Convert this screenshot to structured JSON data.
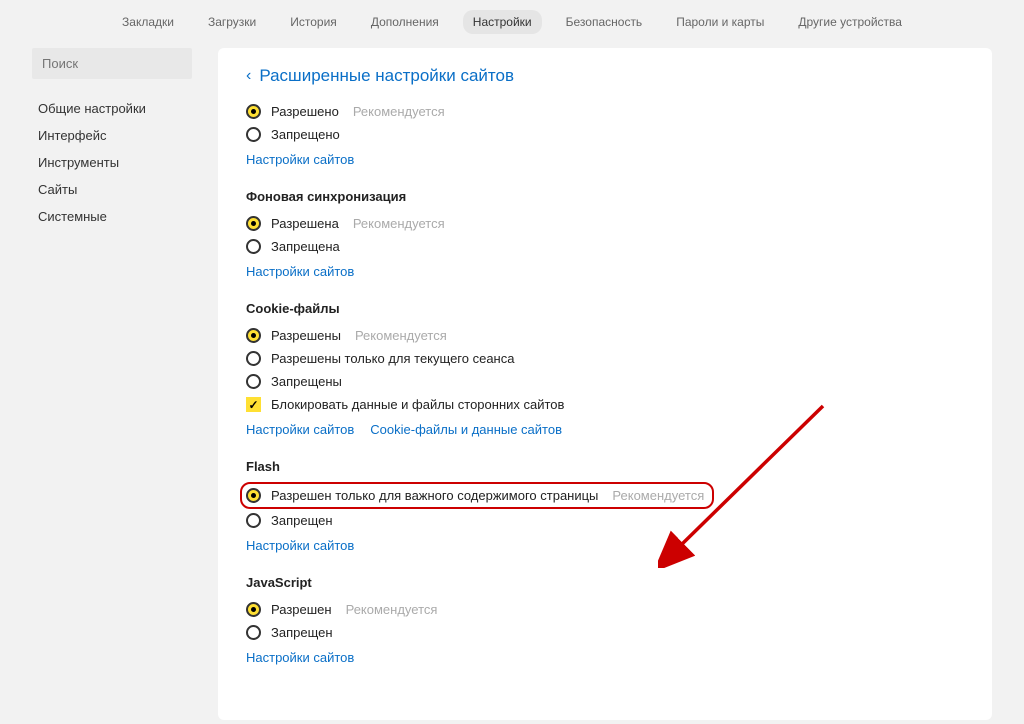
{
  "topnav": {
    "items": [
      "Закладки",
      "Загрузки",
      "История",
      "Дополнения",
      "Настройки",
      "Безопасность",
      "Пароли и карты",
      "Другие устройства"
    ],
    "activeIndex": 4
  },
  "sidebar": {
    "search_placeholder": "Поиск",
    "items": [
      "Общие настройки",
      "Интерфейс",
      "Инструменты",
      "Сайты",
      "Системные"
    ]
  },
  "page": {
    "title": "Расширенные настройки сайтов"
  },
  "sections": {
    "first": {
      "allowed": "Разрешено",
      "denied": "Запрещено",
      "hint": "Рекомендуется",
      "link": "Настройки сайтов"
    },
    "bgsync": {
      "title": "Фоновая синхронизация",
      "allowed": "Разрешена",
      "denied": "Запрещена",
      "hint": "Рекомендуется",
      "link": "Настройки сайтов"
    },
    "cookies": {
      "title": "Cookie-файлы",
      "allowed": "Разрешены",
      "session": "Разрешены только для текущего сеанса",
      "denied": "Запрещены",
      "block_third": "Блокировать данные и файлы сторонних сайтов",
      "hint": "Рекомендуется",
      "link1": "Настройки сайтов",
      "link2": "Cookie-файлы и данные сайтов"
    },
    "flash": {
      "title": "Flash",
      "important": "Разрешен только для важного содержимого страницы",
      "denied": "Запрещен",
      "hint": "Рекомендуется",
      "link": "Настройки сайтов"
    },
    "js": {
      "title": "JavaScript",
      "allowed": "Разрешен",
      "denied": "Запрещен",
      "hint": "Рекомендуется",
      "link": "Настройки сайтов"
    }
  }
}
